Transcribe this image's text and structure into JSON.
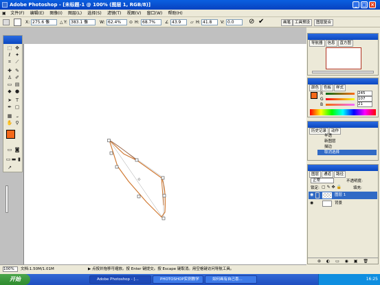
{
  "window": {
    "title": "Adobe Photoshop - [未标题-1 @ 100% (图层 1, RGB/8)]"
  },
  "menu": [
    "文件(F)",
    "编辑(E)",
    "图像(I)",
    "图层(L)",
    "选择(S)",
    "滤镜(T)",
    "视图(V)",
    "窗口(W)",
    "帮助(H)"
  ],
  "options": {
    "x_label": "X:",
    "x_value": "275.6 像",
    "y_label": "Y:",
    "y_value": "383.1 像",
    "w_label": "W:",
    "w_value": "62.4%",
    "h_label": "H:",
    "h_value": "68.7%",
    "angle_value": "43.9",
    "hskew_label": "H:",
    "hskew_value": "41.8",
    "vskew_label": "V:",
    "vskew_value": "0.0"
  },
  "right_tabs": [
    "画笔",
    "工具预设",
    "图层复合"
  ],
  "navigator": {
    "tabs": [
      "导航器",
      "信息",
      "直方图"
    ]
  },
  "color_panel": {
    "tabs": [
      "颜色",
      "色板",
      "样式"
    ],
    "r_label": "R",
    "r_value": "245",
    "g_label": "G",
    "g_value": "107",
    "b_label": "B",
    "b_value": "21",
    "fg_color": "#f5691a"
  },
  "history": {
    "tabs": [
      "历史记录",
      "动作"
    ],
    "items": [
      "半透",
      "新图层",
      "描边",
      "取消选择"
    ]
  },
  "layers": {
    "tabs": [
      "图层",
      "通道",
      "路径"
    ],
    "blend_mode": "正常",
    "opacity_label": "不透明度:",
    "lock_label": "锁定:",
    "fill_label": "填充:",
    "rows": [
      {
        "name": "图层 1",
        "selected": true
      },
      {
        "name": "背景",
        "selected": false
      }
    ]
  },
  "status": {
    "zoom": "100%",
    "doc": "文档:1.50M/1.01M",
    "hint": "▶ 点按并拖移可缩放。按 Enter 键提交。按 Escape 键取消。用空格键访问导航工具。"
  },
  "taskbar": {
    "start": "开始",
    "tasks": [
      "Adobe Photoshop - [...",
      "PHOTOSHOP实例教学",
      "如何画有自己喜..."
    ],
    "clock": "16:25"
  }
}
